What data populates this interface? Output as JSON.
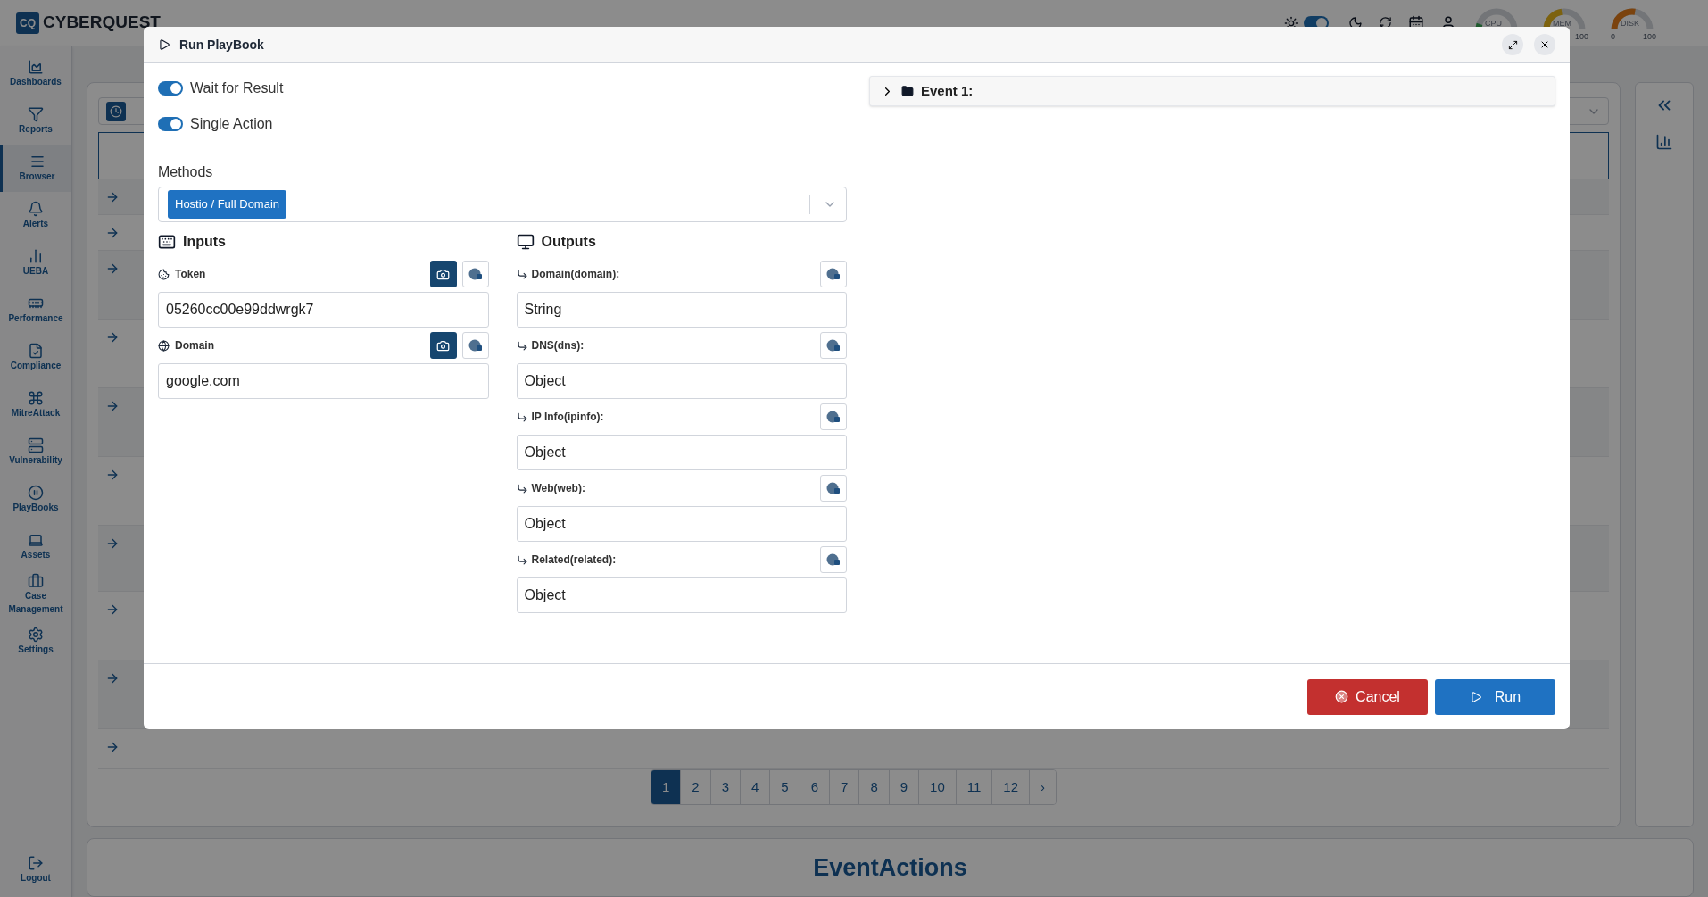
{
  "app": {
    "logo_mark": "CQ",
    "logo_text": "CYBERQUEST"
  },
  "topbar": {
    "theme_toggle_on": true,
    "gauges": [
      {
        "label": "CPU"
      },
      {
        "label": "MEM",
        "max_label": "100"
      },
      {
        "label": "DISK",
        "min_label": "0",
        "max_label": "100"
      }
    ]
  },
  "sidebar": {
    "items": [
      {
        "label": "Dashboards",
        "selected": false
      },
      {
        "label": "Reports",
        "selected": false
      },
      {
        "label": "Browser",
        "selected": true
      },
      {
        "label": "Alerts",
        "selected": false
      },
      {
        "label": "UEBA",
        "selected": false
      },
      {
        "label": "Performance",
        "selected": false
      },
      {
        "label": "Compliance",
        "selected": false
      },
      {
        "label": "MitreAttack",
        "selected": false
      },
      {
        "label": "Vulnerability",
        "selected": false
      },
      {
        "label": "PlayBooks",
        "selected": false
      },
      {
        "label": "Assets",
        "selected": false
      },
      {
        "label": "Case Management",
        "selected": false
      },
      {
        "label": "Settings",
        "selected": false
      }
    ],
    "logout": "Logout"
  },
  "pagination": {
    "pages": [
      {
        "label": "1",
        "selected": true
      },
      {
        "label": "2",
        "selected": false
      },
      {
        "label": "3",
        "selected": false
      },
      {
        "label": "4",
        "selected": false
      },
      {
        "label": "5",
        "selected": false
      },
      {
        "label": "6",
        "selected": false
      },
      {
        "label": "7",
        "selected": false
      },
      {
        "label": "8",
        "selected": false
      },
      {
        "label": "9",
        "selected": false
      },
      {
        "label": "10",
        "selected": false
      },
      {
        "label": "11",
        "selected": false
      },
      {
        "label": "12",
        "selected": false
      }
    ],
    "next": "›"
  },
  "section_title": "EventActions",
  "dialog": {
    "title": "Run PlayBook",
    "toggles": [
      {
        "label": "Wait for Result",
        "on": true
      },
      {
        "label": "Single Action",
        "on": true
      }
    ],
    "methods": {
      "label": "Methods",
      "chips": [
        "Hostio / Full Domain"
      ]
    },
    "inputs": {
      "title": "Inputs",
      "fields": [
        {
          "label": "Token",
          "kind": "token",
          "value": "05260cc00e99ddwrgk7"
        },
        {
          "label": "Domain",
          "kind": "domain",
          "value": "google.com"
        }
      ]
    },
    "outputs": {
      "title": "Outputs",
      "fields": [
        {
          "label": "Domain(domain):",
          "value": "String"
        },
        {
          "label": "DNS(dns):",
          "value": "Object"
        },
        {
          "label": "IP Info(ipinfo):",
          "value": "Object"
        },
        {
          "label": "Web(web):",
          "value": "Object"
        },
        {
          "label": "Related(related):",
          "value": "Object"
        }
      ]
    },
    "events": [
      {
        "label": "Event 1:",
        "expanded": false
      }
    ],
    "buttons": {
      "cancel": "Cancel",
      "run": "Run"
    }
  }
}
